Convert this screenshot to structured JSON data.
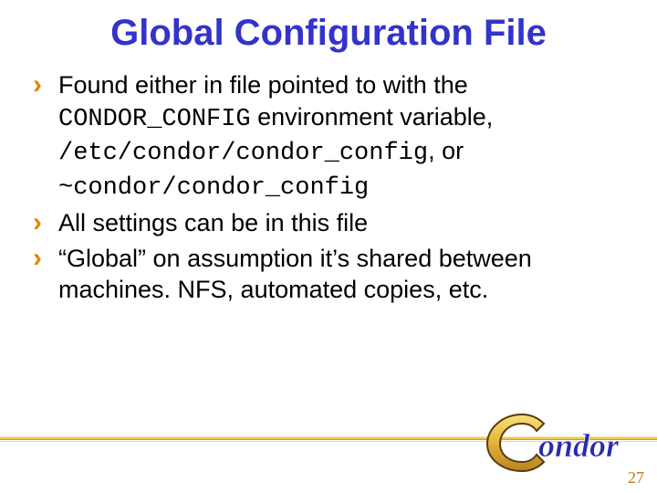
{
  "title": "Global Configuration File",
  "bullets": [
    {
      "runs": [
        {
          "t": "Found either in file pointed to with the "
        },
        {
          "t": "CONDOR_CONFIG",
          "mono": true
        },
        {
          "t": " environment variable, "
        },
        {
          "t": "/etc/condor/condor_config",
          "mono": true
        },
        {
          "t": ", or "
        },
        {
          "t": "~condor/condor_config",
          "mono": true
        }
      ]
    },
    {
      "runs": [
        {
          "t": "All settings can be in this file"
        }
      ]
    },
    {
      "runs": [
        {
          "t": "“Global” on assumption it’s shared between machines. NFS, automated copies, etc."
        }
      ]
    }
  ],
  "logo_text": "ondor",
  "page_number": "27",
  "colors": {
    "title": "#3333cc",
    "bullet_marker": "#dd8800",
    "page_number": "#bd792a"
  }
}
